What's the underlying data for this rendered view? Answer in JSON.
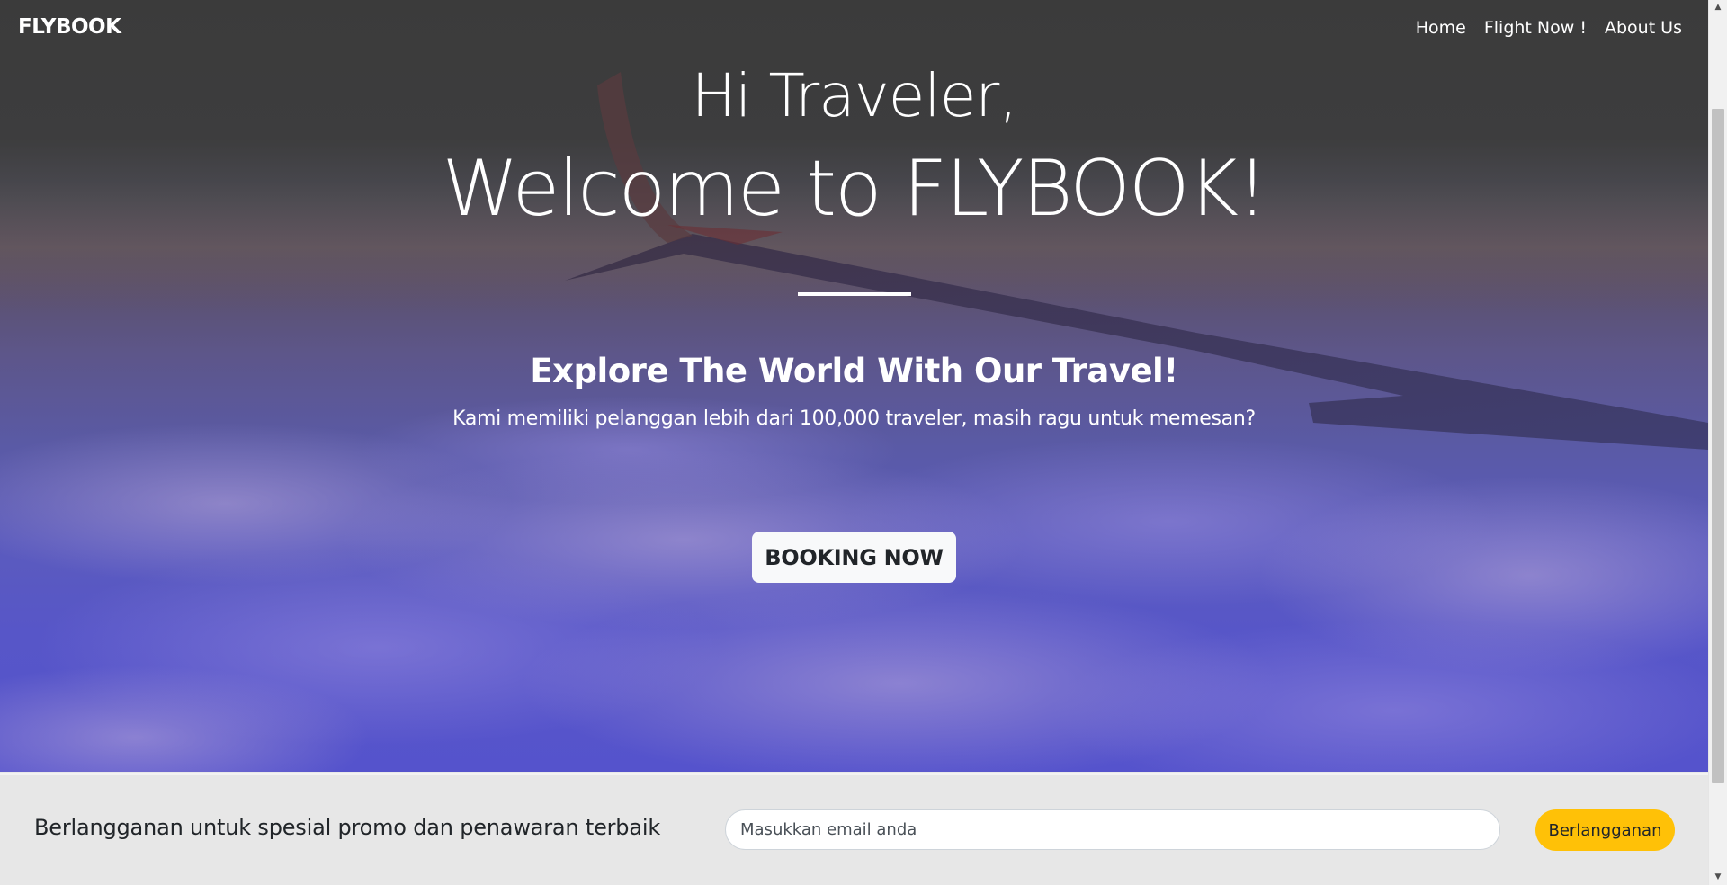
{
  "navbar": {
    "brand": "FLYBOOK",
    "links": [
      "Home",
      "Flight Now !",
      "About Us"
    ]
  },
  "hero": {
    "greeting": "Hi Traveler,",
    "welcome": "Welcome to FLYBOOK!",
    "tagline": "Explore The World With Our Travel!",
    "subtext": "Kami memiliki pelanggan lebih dari 100,000 traveler, masih ragu untuk memesan?",
    "booking_label": "BOOKING NOW"
  },
  "subscribe": {
    "text": "Berlangganan untuk spesial promo dan penawaran terbaik",
    "email_placeholder": "Masukkan email anda",
    "email_value": "",
    "button_label": "Berlangganan"
  },
  "colors": {
    "accent": "#ffc107",
    "hero_top": "#3b3b3b",
    "hero_bottom": "#5553cc",
    "subscribe_bg": "#e7e7e7"
  },
  "icons": {
    "scroll_up": "scroll-up-arrow-icon",
    "scroll_down": "scroll-down-arrow-icon"
  }
}
